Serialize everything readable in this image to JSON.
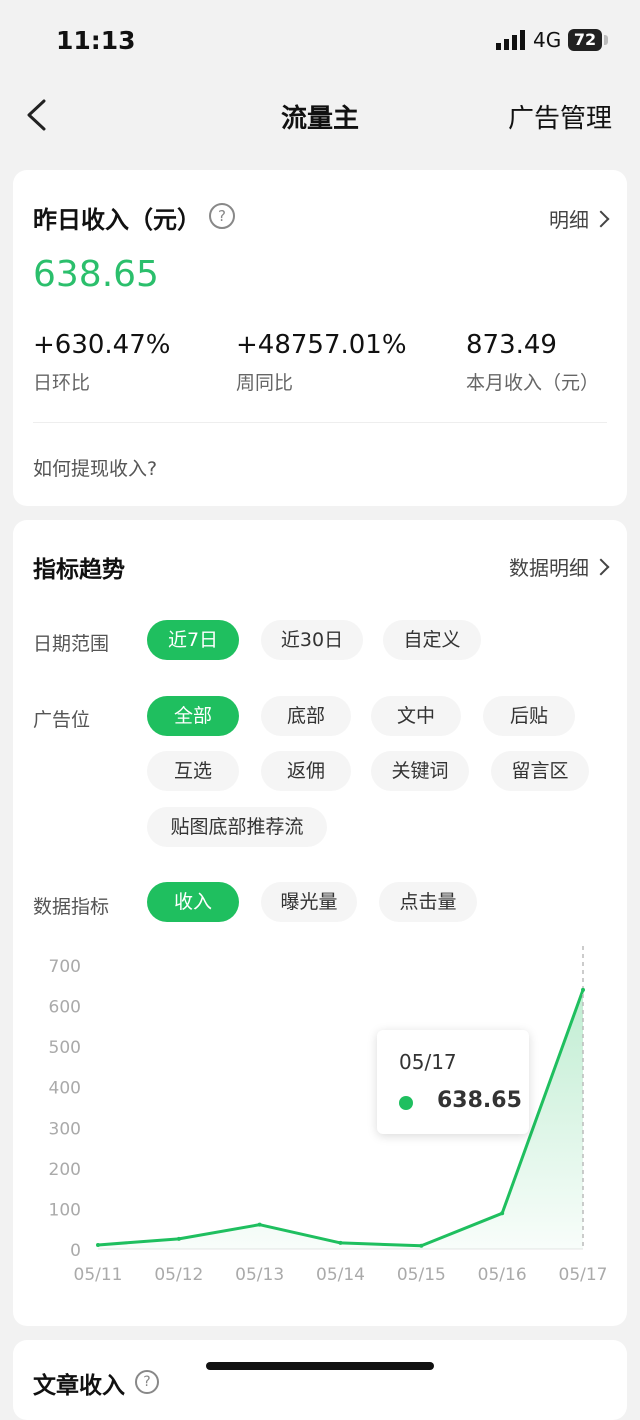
{
  "status_bar": {
    "time": "11:13",
    "network": "4G",
    "battery": "72"
  },
  "nav": {
    "title": "流量主",
    "right_link": "广告管理"
  },
  "income": {
    "title": "昨日收入（元）",
    "help": "?",
    "detail_link": "明细",
    "amount": "638.65",
    "stats": [
      {
        "value": "+630.47%",
        "label": "日环比"
      },
      {
        "value": "+48757.01%",
        "label": "周同比"
      },
      {
        "value": "873.49",
        "label": "本月收入（元）"
      }
    ],
    "withdraw_link": "如何提现收入?"
  },
  "trend": {
    "title": "指标趋势",
    "detail_link": "数据明细",
    "date_range": {
      "label": "日期范围",
      "options": [
        "近7日",
        "近30日",
        "自定义"
      ],
      "selected": "近7日"
    },
    "ad_slot": {
      "label": "广告位",
      "options": [
        "全部",
        "底部",
        "文中",
        "后贴",
        "互选",
        "返佣",
        "关键词",
        "留言区",
        "贴图底部推荐流"
      ],
      "selected": "全部"
    },
    "metric": {
      "label": "数据指标",
      "options": [
        "收入",
        "曝光量",
        "点击量"
      ],
      "selected": "收入"
    },
    "tooltip": {
      "date": "05/17",
      "value": "638.65"
    }
  },
  "colors": {
    "accent": "#1fbf5f",
    "amount": "#2bbf6c"
  },
  "chart_data": {
    "type": "area",
    "categories": [
      "05/11",
      "05/12",
      "05/13",
      "05/14",
      "05/15",
      "05/16",
      "05/17"
    ],
    "values": [
      10,
      25,
      60,
      15,
      8,
      88,
      638.65
    ],
    "y_ticks": [
      "0",
      "100",
      "200",
      "300",
      "400",
      "500",
      "600",
      "700"
    ],
    "ylim": [
      0,
      700
    ],
    "grid": false
  },
  "article": {
    "title": "文章收入",
    "help": "?"
  }
}
